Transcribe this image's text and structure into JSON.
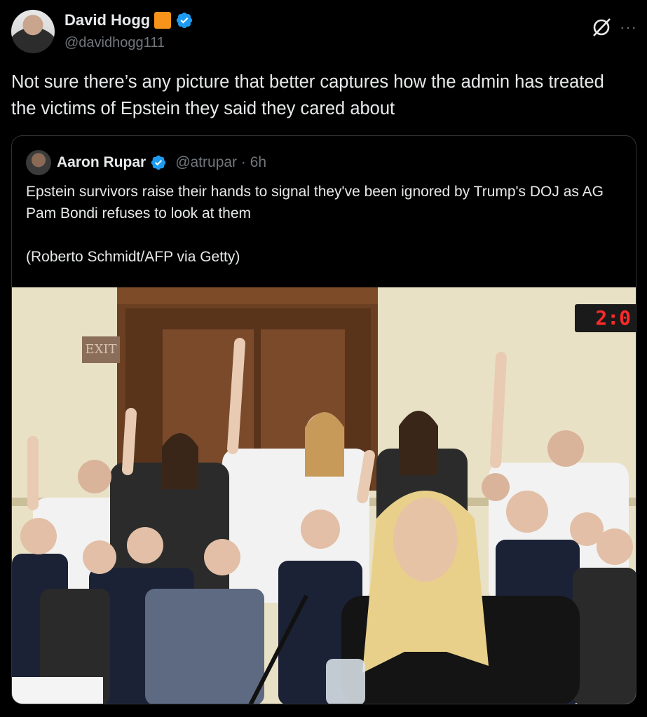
{
  "post": {
    "author_name": "David Hogg",
    "author_handle": "@davidhogg111",
    "text": "Not sure there’s any picture that better captures how the admin has treated the victims of Epstein they said they cared about",
    "icons": {
      "verified": "verified-icon",
      "org_badge": "orange-square-badge",
      "grok": "grok-icon",
      "more": "more-icon"
    },
    "more_label": "···"
  },
  "quote": {
    "author_name": "Aaron Rupar",
    "author_handle": "@atrupar · 6h",
    "text": "Epstein survivors raise their hands to signal they've been ignored by Trump's DOJ as AG Pam Bondi refuses to look at them",
    "credit": "(Roberto Schmidt/AFP via Getty)",
    "photo": {
      "timer": "2:0",
      "exit_sign": "EXIT"
    }
  },
  "colors": {
    "background": "#000000",
    "text": "#e7e9ea",
    "muted": "#71767b",
    "verified_blue": "#1d9bf0",
    "org_badge": "#f7931a",
    "border": "#2f3336"
  }
}
